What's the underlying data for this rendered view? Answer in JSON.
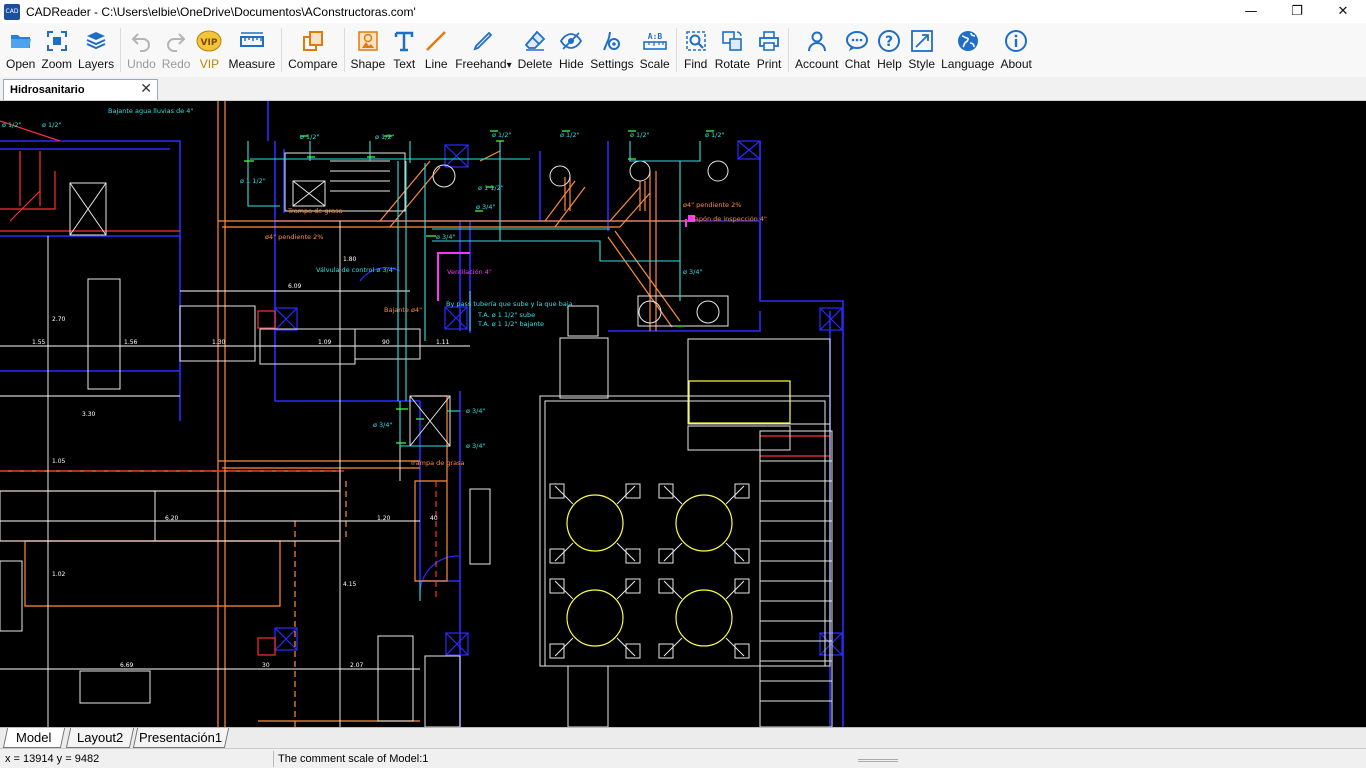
{
  "window": {
    "logo_text": "CAD",
    "title": "CADReader - C:\\Users\\elbie\\OneDrive\\Documentos\\AConstructoras.com'",
    "minimize": "—",
    "restore": "❐",
    "close": "✕"
  },
  "toolbar": {
    "items": [
      {
        "id": "open",
        "label": "Open",
        "icon": "folder-icon"
      },
      {
        "id": "zoom",
        "label": "Zoom",
        "icon": "zoom-extents-icon"
      },
      {
        "id": "layers",
        "label": "Layers",
        "icon": "layers-icon"
      },
      {
        "id": "undo",
        "label": "Undo",
        "icon": "undo-icon",
        "disabled": true
      },
      {
        "id": "redo",
        "label": "Redo",
        "icon": "redo-icon",
        "disabled": true
      },
      {
        "id": "vip",
        "label": "VIP",
        "icon": "vip-badge-icon",
        "badge": "VIP"
      },
      {
        "id": "measure",
        "label": "Measure",
        "icon": "ruler-icon"
      },
      {
        "id": "compare",
        "label": "Compare",
        "icon": "compare-icon"
      },
      {
        "id": "shape",
        "label": "Shape",
        "icon": "shape-icon"
      },
      {
        "id": "text",
        "label": "Text",
        "icon": "text-icon"
      },
      {
        "id": "line",
        "label": "Line",
        "icon": "line-icon"
      },
      {
        "id": "freehand",
        "label": "Freehand",
        "icon": "pen-icon",
        "dropdown": "▾"
      },
      {
        "id": "delete",
        "label": "Delete",
        "icon": "eraser-icon"
      },
      {
        "id": "hide",
        "label": "Hide",
        "icon": "hide-eye-icon"
      },
      {
        "id": "settings",
        "label": "Settings",
        "icon": "settings-icon"
      },
      {
        "id": "scale",
        "label": "Scale",
        "icon": "scale-icon",
        "badge": "A:B"
      },
      {
        "id": "find",
        "label": "Find",
        "icon": "find-icon"
      },
      {
        "id": "rotate",
        "label": "Rotate",
        "icon": "rotate-icon"
      },
      {
        "id": "print",
        "label": "Print",
        "icon": "printer-icon"
      },
      {
        "id": "account",
        "label": "Account",
        "icon": "user-icon"
      },
      {
        "id": "chat",
        "label": "Chat",
        "icon": "chat-icon"
      },
      {
        "id": "help",
        "label": "Help",
        "icon": "help-icon"
      },
      {
        "id": "style",
        "label": "Style",
        "icon": "style-icon"
      },
      {
        "id": "language",
        "label": "Language",
        "icon": "globe-icon"
      },
      {
        "id": "about",
        "label": "About",
        "icon": "info-icon"
      }
    ]
  },
  "document_tab": {
    "label": "Hidrosanitario",
    "close": "✕"
  },
  "drawing": {
    "annotations": [
      "Bajante agua lluvias de 4\"",
      "ø 1/2\"",
      "ø 1/2\"",
      "ø 1/2\"",
      "ø 1/2\"",
      "ø 1/2\"",
      "ø 1/2\"",
      "ø 1/2\"",
      "ø 1/2\"",
      "ø 1 1/2\"",
      "ø 1 1/2\"",
      "Trampa de grasa",
      "ø 3/4\"",
      "ø4\" pendiente 2%",
      "ø4\" pendiente 2%",
      "Tapón de inspección 4\"",
      "ø 3/4\"",
      "Válvula de control ø 3/4\"",
      "Ventilación 4\"",
      "ø 3/4\"",
      "By pass tubería que sube y la que baja",
      "T.A. ø 1 1/2\" sube",
      "T.A. ø 1 1/2\" bajante",
      "Bajante ø4\"",
      "ø 3/4\"",
      "ø 3/4\"",
      "ø 3/4\"",
      "Trampa de grasa"
    ],
    "dimensions": [
      "6.09",
      "1.55",
      "1.56",
      "1.30",
      "1.09",
      "90",
      "1.11",
      "3.30",
      "2.70",
      "1.05",
      "6.20",
      "1.20",
      "40",
      "1.02",
      "6.69",
      "2.07",
      "4.15",
      "1.80",
      "30"
    ],
    "colors": {
      "background": "#000000",
      "walls": "#2b2bff",
      "pipes_orange": "#ff8c3a",
      "pipes_cyan": "#33e0e0",
      "pipes_green": "#44ff44",
      "vent_magenta": "#ff33ff",
      "furniture_white": "#ffffff",
      "table_yellow": "#ffff44",
      "dims_red": "#ff3030"
    }
  },
  "layout_tabs": [
    {
      "label": "Model",
      "active": true
    },
    {
      "label": "Layout2",
      "active": false
    },
    {
      "label": "Presentación1",
      "active": false
    }
  ],
  "status": {
    "coords": "x = 13914 y = 9482",
    "scale": "The comment scale of Model:1"
  }
}
